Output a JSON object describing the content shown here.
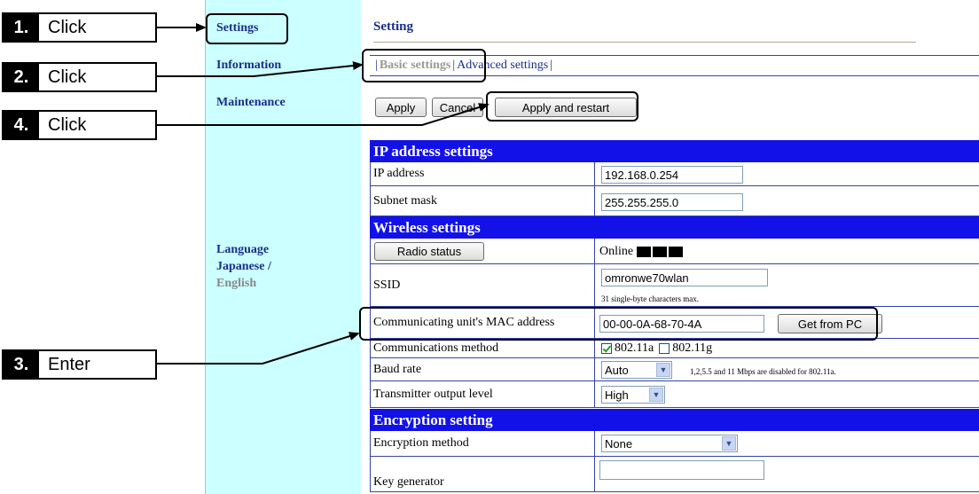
{
  "callouts": [
    {
      "num": "1.",
      "label": "Click"
    },
    {
      "num": "2.",
      "label": "Click"
    },
    {
      "num": "4.",
      "label": "Click"
    },
    {
      "num": "3.",
      "label": "Enter"
    }
  ],
  "sidebar": {
    "settings": "Settings",
    "information": "Information",
    "maintenance": "Maintenance",
    "language_label": "Language",
    "japanese": "Japanese /",
    "english": "English"
  },
  "main": {
    "title": "Setting",
    "tabs": {
      "sep": "|",
      "basic": "Basic settings",
      "advanced": "Advanced settings"
    },
    "buttons": {
      "apply": "Apply",
      "cancel": "Cancel",
      "apply_restart": "Apply and restart"
    }
  },
  "ip_section": {
    "heading": "IP address settings",
    "ip_label": "IP address",
    "ip_value": "192.168.0.254",
    "mask_label": "Subnet mask",
    "mask_value": "255.255.255.0"
  },
  "wireless_section": {
    "heading": "Wireless settings",
    "radio_button": "Radio status",
    "online": "Online",
    "ssid_label": "SSID",
    "ssid_value": "omronwe70wlan",
    "ssid_note": "31 single-byte characters max.",
    "mac_label": "Communicating unit's MAC address",
    "mac_value": "00-00-0A-68-70-4A",
    "get_from_pc": "Get from PC",
    "comm_label": "Communications method",
    "opt_a": "802.11a",
    "opt_g": "802.11g",
    "opt_a_checked": true,
    "opt_g_checked": false,
    "baud_label": "Baud rate",
    "baud_value": "Auto",
    "baud_note": "1,2,5.5 and 11 Mbps are disabled for 802.11a.",
    "tx_label": "Transmitter output level",
    "tx_value": "High"
  },
  "encryption_section": {
    "heading": "Encryption setting",
    "method_label": "Encryption method",
    "method_value": "None",
    "keygen_label": "Key generator",
    "keygen_value": ""
  }
}
